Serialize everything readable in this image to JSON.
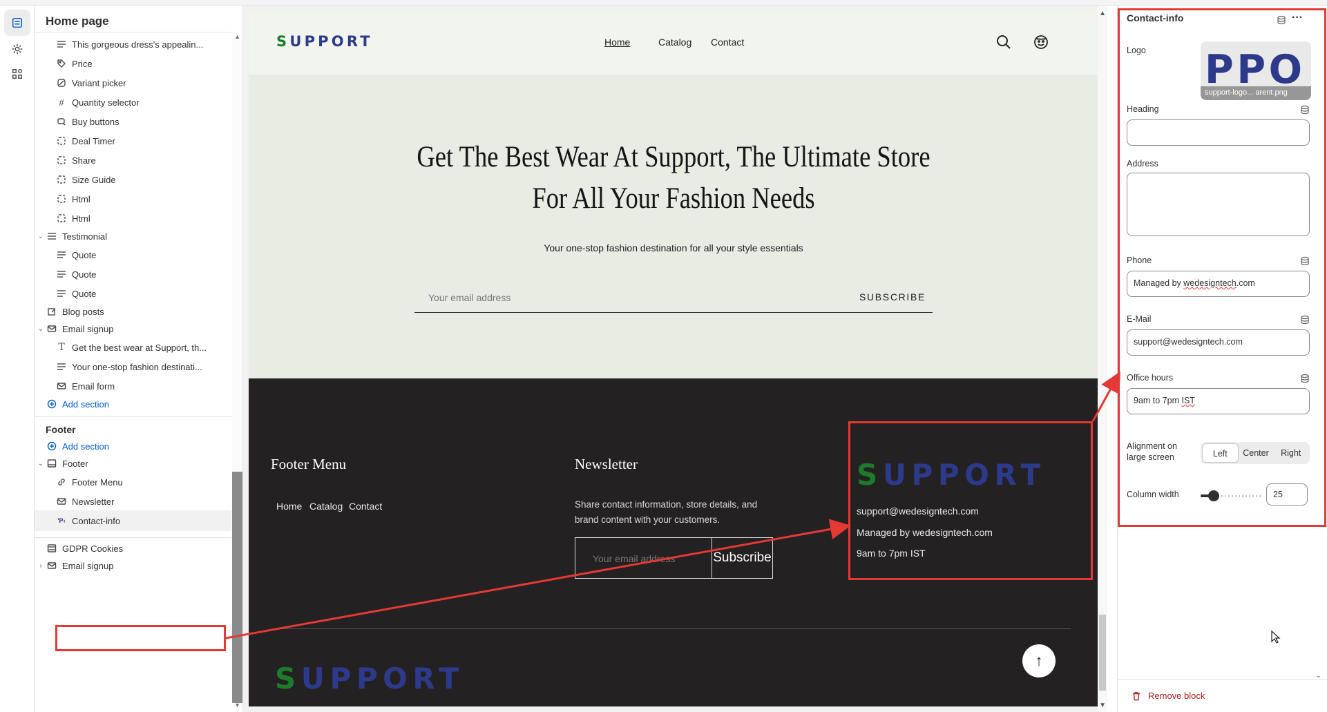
{
  "sidebar": {
    "title": "Home page",
    "items": [
      {
        "label": "This gorgeous dress's appealin...",
        "icon": "text-lines-icon"
      },
      {
        "label": "Price",
        "icon": "price-tag-icon"
      },
      {
        "label": "Variant picker",
        "icon": "variant-icon"
      },
      {
        "label": "Quantity selector",
        "icon": "hash-icon"
      },
      {
        "label": "Buy buttons",
        "icon": "cart-icon"
      },
      {
        "label": "Deal Timer",
        "icon": "dashed-square-icon"
      },
      {
        "label": "Share",
        "icon": "dashed-square-icon"
      },
      {
        "label": "Size Guide",
        "icon": "dashed-square-icon"
      },
      {
        "label": "Html",
        "icon": "dashed-square-icon"
      },
      {
        "label": "Html",
        "icon": "dashed-square-icon"
      },
      {
        "label": "Testimonial",
        "icon": "testimonial-icon"
      },
      {
        "label": "Quote",
        "icon": "text-lines-icon"
      },
      {
        "label": "Quote",
        "icon": "text-lines-icon"
      },
      {
        "label": "Quote",
        "icon": "text-lines-icon"
      },
      {
        "label": "Blog posts",
        "icon": "edit-icon"
      },
      {
        "label": "Email signup",
        "icon": "mail-icon"
      },
      {
        "label": "Get the best wear at Support, th...",
        "icon": "heading-icon"
      },
      {
        "label": "Your one-stop fashion destinati...",
        "icon": "text-lines-icon"
      },
      {
        "label": "Email form",
        "icon": "mail-icon"
      },
      {
        "label": "Add section",
        "icon": "plus-circle-icon"
      },
      {
        "label": "Footer",
        "icon": "section-label"
      },
      {
        "label": "Add section",
        "icon": "plus-circle-icon"
      },
      {
        "label": "Footer",
        "icon": "footer-icon"
      },
      {
        "label": "Footer Menu",
        "icon": "link-icon"
      },
      {
        "label": "Newsletter",
        "icon": "mail-icon"
      },
      {
        "label": "Contact-info",
        "icon": "logo-icon"
      },
      {
        "label": "GDPR Cookies",
        "icon": "section-icon"
      },
      {
        "label": "Email signup",
        "icon": "mail-icon"
      }
    ]
  },
  "store": {
    "logo": "UPPORT",
    "logo_initial": "S",
    "nav": [
      "Home",
      "Catalog",
      "Contact"
    ],
    "hero_title": "Get The Best Wear At Support, The Ultimate Store For All Your Fashion Needs",
    "hero_subtitle": "Your one-stop fashion destination for all your style essentials",
    "email_placeholder": "Your email address",
    "subscribe": "SUBSCRIBE",
    "footer_menu_heading": "Footer Menu",
    "footer_links": [
      "Home",
      "Catalog",
      "Contact"
    ],
    "newsletter_heading": "Newsletter",
    "newsletter_text": "Share contact information, store details, and brand content with your customers.",
    "newsletter_placeholder": "Your email address",
    "newsletter_button": "Subscribe",
    "contact_email": "support@wedesigntech.com",
    "contact_phone": "Managed by wedesigntech.com",
    "contact_hours": "9am to 7pm IST",
    "to_top": "↑"
  },
  "panel": {
    "title": "Contact-info",
    "logo_label": "Logo",
    "logo_preview": "PPO",
    "logo_filename": "support-logo... arent.png",
    "heading_label": "Heading",
    "heading_value": "",
    "address_label": "Address",
    "address_value": "",
    "phone_label": "Phone",
    "phone_prefix": "Managed by ",
    "phone_domain": "wedesigntech",
    "phone_suffix": ".com",
    "email_label": "E-Mail",
    "email_value": "support@wedesigntech.com",
    "hours_label": "Office hours",
    "hours_prefix": "9am to 7pm ",
    "hours_tz": "IST",
    "alignment_label": "Alignment on large screen",
    "alignment_options": [
      "Left",
      "Center",
      "Right"
    ],
    "alignment_selected": "Left",
    "column_width_label": "Column width",
    "column_width_value": "25",
    "column_width_level": 25,
    "remove_label": "Remove block"
  },
  "colors": {
    "accent": "#005bd3",
    "highlight": "#e53935",
    "logo_blue": "#2d3a8c",
    "logo_green": "#1c7c2c",
    "footer_bg": "#242122",
    "hero_bg": "#e8ece3"
  }
}
